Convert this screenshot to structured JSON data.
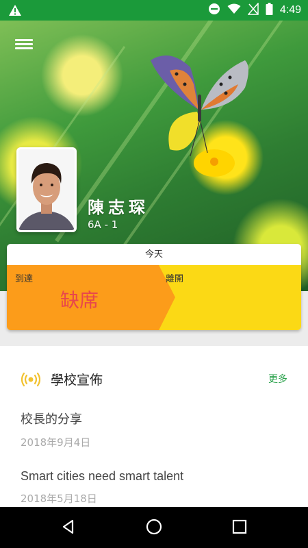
{
  "status_bar": {
    "time": "4:49"
  },
  "student": {
    "name": "陳志琛",
    "class": "6A - 1"
  },
  "attendance": {
    "header": "今天",
    "arrive_label": "到達",
    "leave_label": "離開",
    "status": "缺席"
  },
  "announcements": {
    "title": "學校宣佈",
    "more_label": "更多",
    "items": [
      {
        "title": "校長的分享",
        "date": "2018年9月4日"
      },
      {
        "title": "Smart cities need smart talent",
        "date": "2018年5月18日"
      }
    ]
  },
  "colors": {
    "status_bar": "#1b9a3a",
    "arrive_orange": "#fc9c1a",
    "leave_yellow": "#fbd915",
    "absent_red": "#e8474b",
    "accent_green": "#2ba24c"
  }
}
